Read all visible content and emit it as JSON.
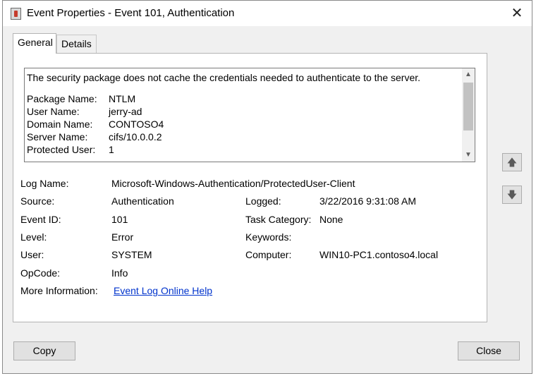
{
  "window": {
    "title": "Event Properties - Event 101, Authentication",
    "close_glyph": "✕"
  },
  "tabs": [
    {
      "label": "General"
    },
    {
      "label": "Details"
    }
  ],
  "description": {
    "message": "The security package does not cache the credentials needed to authenticate to the server.",
    "details": [
      {
        "key": "Package Name:",
        "value": "NTLM"
      },
      {
        "key": "User Name:",
        "value": "jerry-ad"
      },
      {
        "key": "Domain Name:",
        "value": "CONTOSO4"
      },
      {
        "key": "Server Name:",
        "value": "cifs/10.0.0.2"
      },
      {
        "key": "Protected User:",
        "value": "1"
      }
    ]
  },
  "fields": {
    "log_name": {
      "label": "Log Name:",
      "value": "Microsoft-Windows-Authentication/ProtectedUser-Client"
    },
    "source": {
      "label": "Source:",
      "value": "Authentication"
    },
    "logged": {
      "label": "Logged:",
      "value": "3/22/2016 9:31:08 AM"
    },
    "event_id": {
      "label": "Event ID:",
      "value": "101"
    },
    "task_category": {
      "label": "Task Category:",
      "value": "None"
    },
    "level": {
      "label": "Level:",
      "value": "Error"
    },
    "keywords": {
      "label": "Keywords:",
      "value": ""
    },
    "user": {
      "label": "User:",
      "value": "SYSTEM"
    },
    "computer": {
      "label": "Computer:",
      "value": "WIN10-PC1.contoso4.local"
    },
    "opcode": {
      "label": "OpCode:",
      "value": "Info"
    },
    "more_info": {
      "label": "More Information:",
      "link": "Event Log Online Help"
    }
  },
  "nav": {
    "up_glyph": "🡅",
    "down_glyph": "🡇"
  },
  "buttons": {
    "copy": "Copy",
    "close": "Close"
  },
  "scroll": {
    "up_glyph": "▲",
    "down_glyph": "▼"
  }
}
